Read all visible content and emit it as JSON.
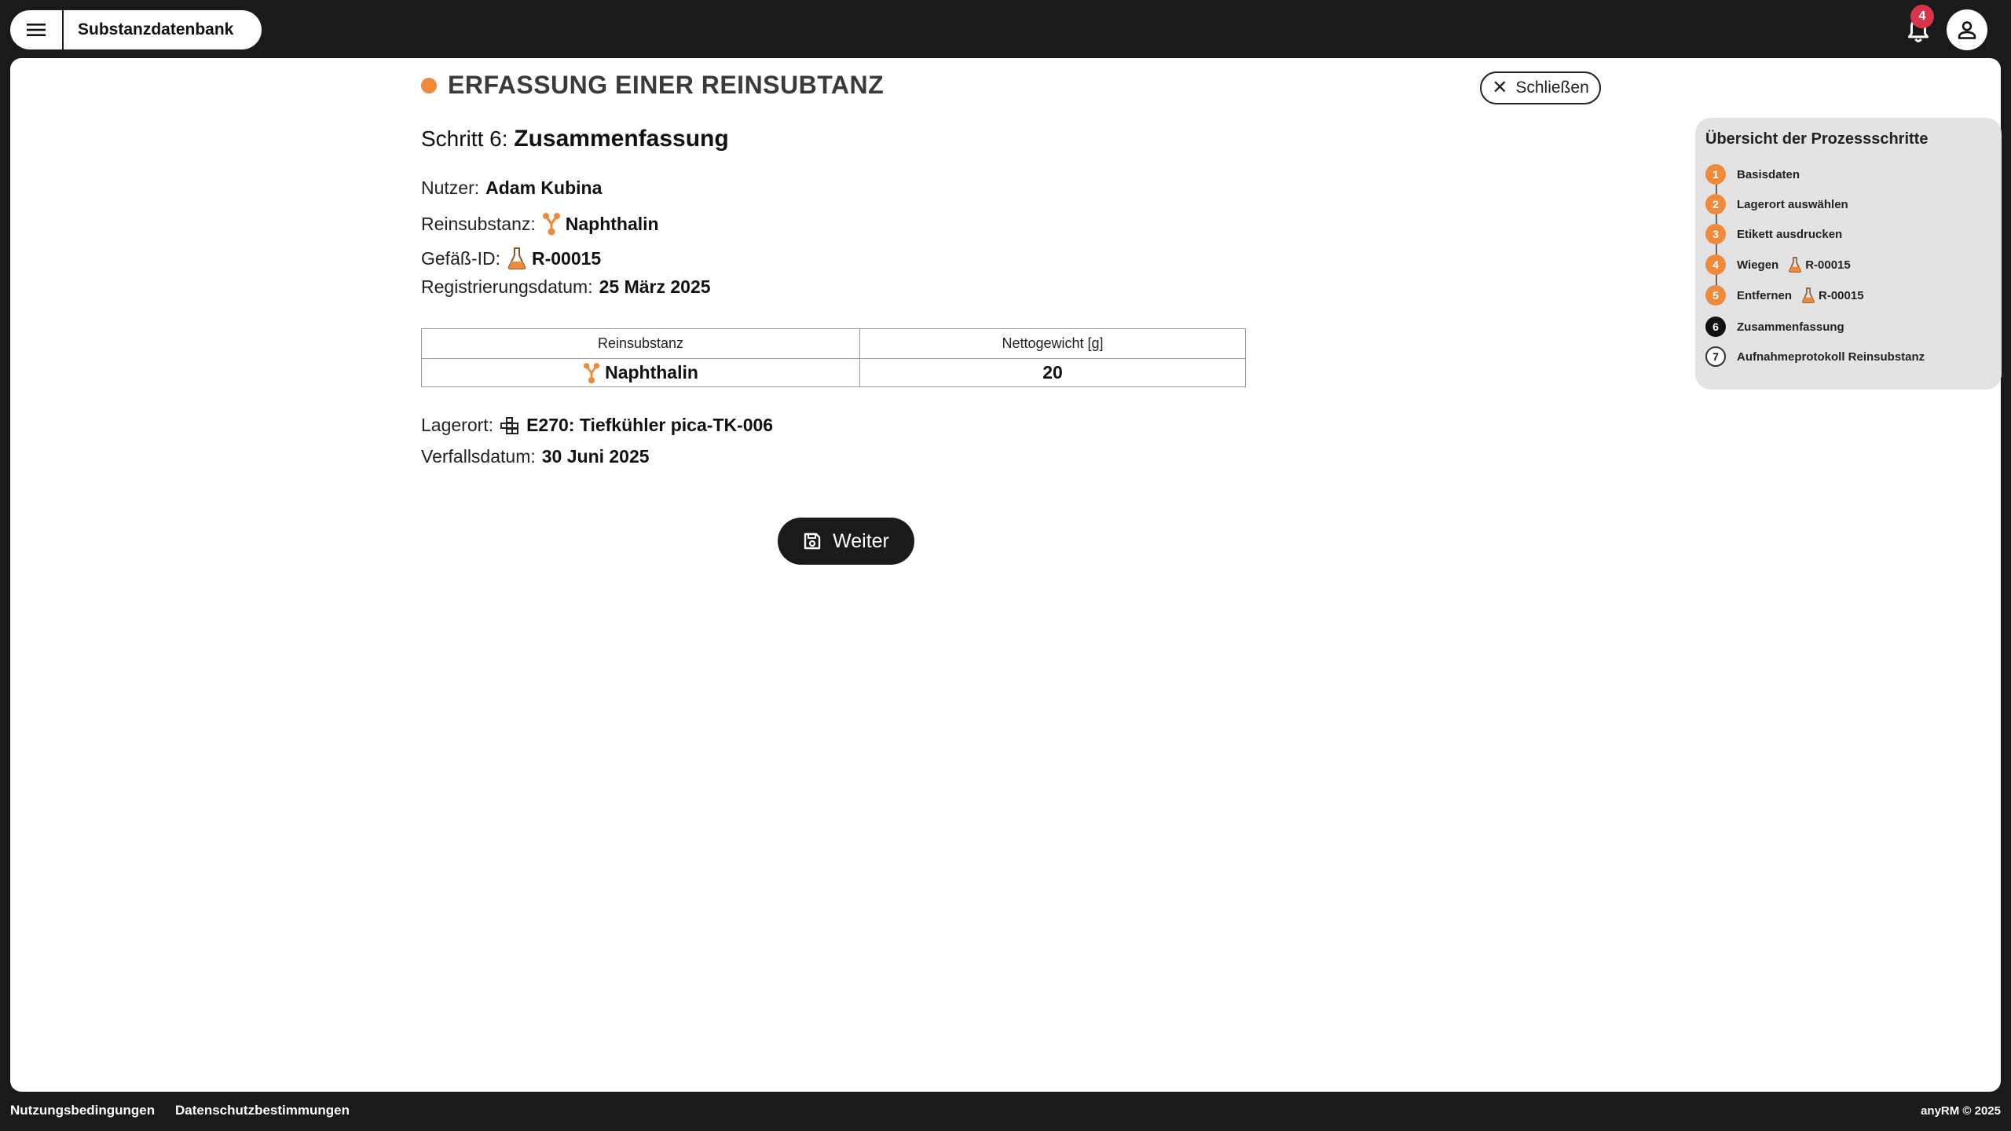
{
  "header": {
    "app_title": "Substanzdatenbank",
    "notification_count": "4"
  },
  "page": {
    "heading": "ERFASSUNG EINER REINSUBTANZ",
    "close_label": "Schließen",
    "step_prefix": "Schritt 6:",
    "step_name": "Zusammenfassung"
  },
  "details": {
    "user_label": "Nutzer:",
    "user_value": "Adam Kubina",
    "substance_label": "Reinsubstanz:",
    "substance_value": "Naphthalin",
    "vessel_label": "Gefäß-ID:",
    "vessel_value": "R-00015",
    "regdate_label": "Registrierungsdatum:",
    "regdate_value": "25 März 2025",
    "location_label": "Lagerort:",
    "location_value": "E270: Tiefkühler pica-TK-006",
    "expiry_label": "Verfallsdatum:",
    "expiry_value": "30 Juni 2025"
  },
  "table": {
    "headers": [
      "Reinsubstanz",
      "Nettogewicht [g]"
    ],
    "rows": [
      {
        "substance": "Naphthalin",
        "net_weight": "20"
      }
    ]
  },
  "actions": {
    "next_label": "Weiter"
  },
  "steps_panel": {
    "title": "Übersicht der Prozessschritte",
    "items": [
      {
        "num": "1",
        "label": "Basisdaten",
        "state": "done"
      },
      {
        "num": "2",
        "label": "Lagerort auswählen",
        "state": "done"
      },
      {
        "num": "3",
        "label": "Etikett ausdrucken",
        "state": "done"
      },
      {
        "num": "4",
        "label": "Wiegen",
        "state": "done",
        "extra": "R-00015"
      },
      {
        "num": "5",
        "label": "Entfernen",
        "state": "done",
        "extra": "R-00015"
      },
      {
        "num": "6",
        "label": "Zusammenfassung",
        "state": "current"
      },
      {
        "num": "7",
        "label": "Aufnahmeprotokoll Reinsubstanz",
        "state": "todo"
      }
    ]
  },
  "footer": {
    "terms": "Nutzungsbedingungen",
    "privacy": "Datenschutzbestimmungen",
    "copyright": "anyRM © 2025"
  },
  "colors": {
    "accent": "#ef8a3a",
    "dark": "#1a1a1a",
    "badge": "#d8344a",
    "panel": "#e3e3e3"
  }
}
